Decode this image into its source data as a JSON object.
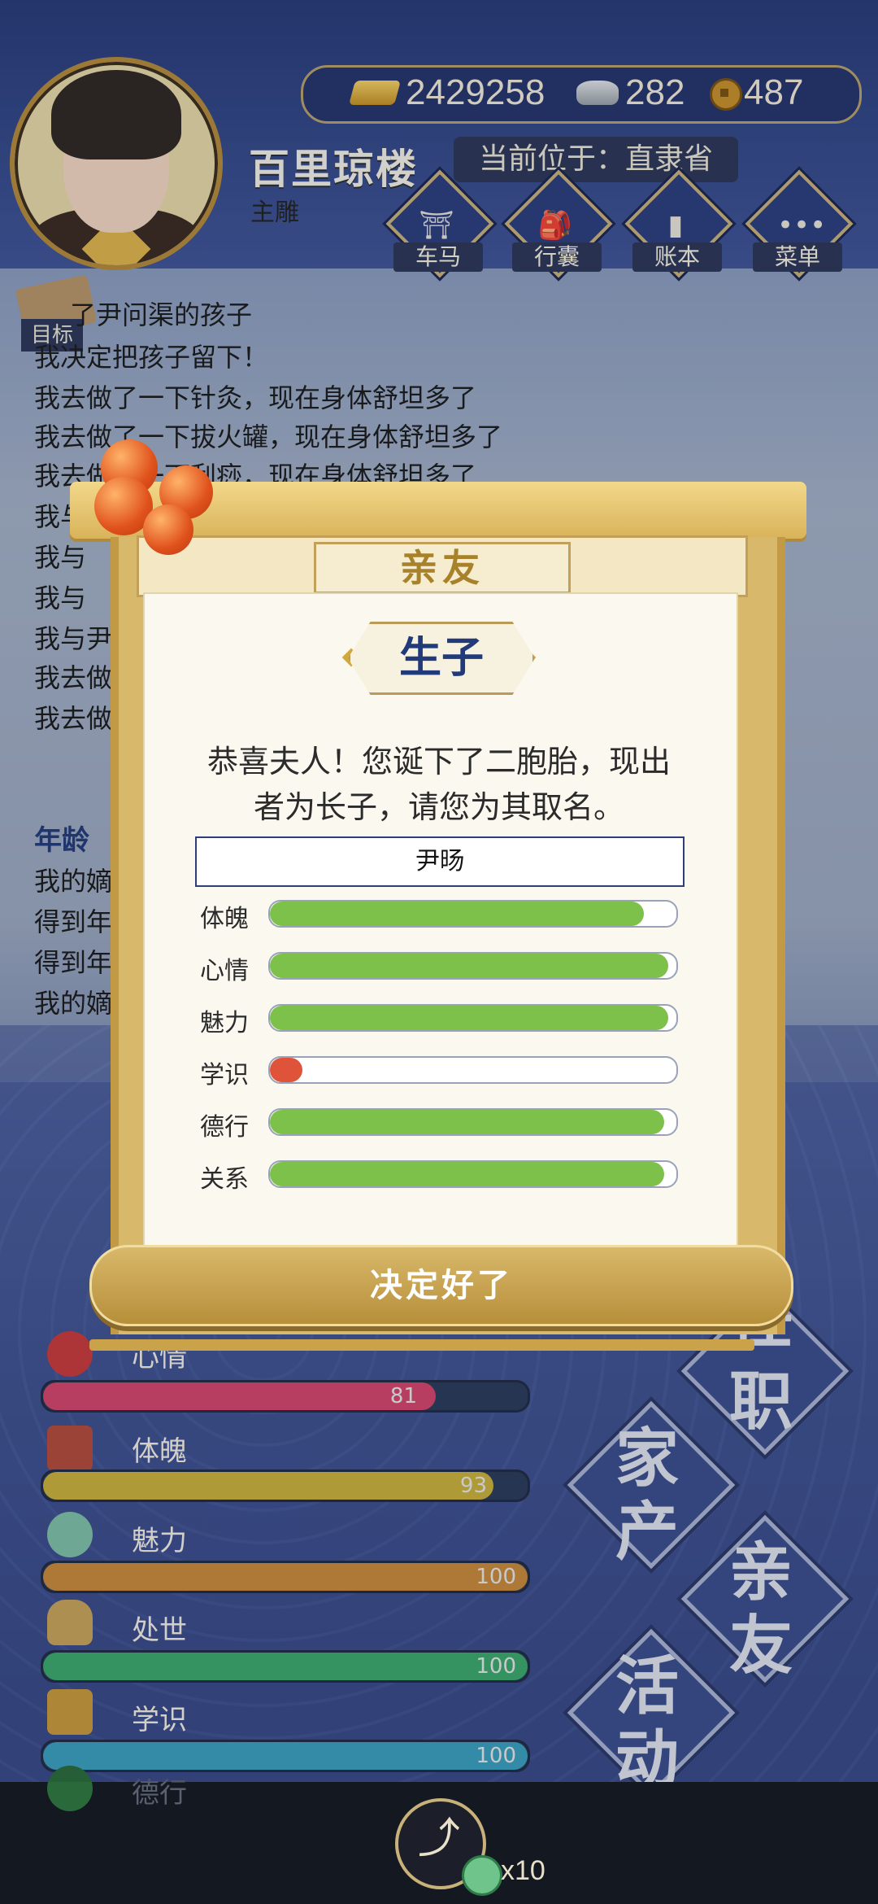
{
  "currency": {
    "gold": "2429258",
    "silver": "282",
    "coins": "487"
  },
  "profile": {
    "name": "百里琼楼",
    "subtitle": "主雕",
    "location": "当前位于：直隶省"
  },
  "nav": [
    {
      "label": "车马",
      "icon": "carriage-icon"
    },
    {
      "label": "行囊",
      "icon": "bag-icon"
    },
    {
      "label": "账本",
      "icon": "ledger-icon"
    },
    {
      "label": "菜单",
      "icon": "menu-icon"
    }
  ],
  "log": {
    "target_label": "目标",
    "lines": [
      "了尹问渠的孩子",
      "我决定把孩子留下！",
      "我去做了一下针灸，现在身体舒坦多了",
      "我去做了一下拔火罐，现在身体舒坦多了",
      "我去做了一下刮痧，现在身体舒坦多了",
      "我与",
      "我与",
      "我与",
      "我与尹",
      "我去做",
      "我去做"
    ],
    "age_label": "年龄",
    "lines2": [
      "我的嫡",
      "得到年",
      "得到年",
      "我的嫡"
    ]
  },
  "stats": [
    {
      "label": "心情",
      "value": 81,
      "display": "81",
      "color": "#d4456b"
    },
    {
      "label": "体魄",
      "value": 93,
      "display": "93",
      "color": "#c9b13a"
    },
    {
      "label": "魅力",
      "value": 100,
      "display": "100",
      "color": "#c98a3a"
    },
    {
      "label": "处世",
      "value": 100,
      "display": "100",
      "color": "#3aa86a"
    },
    {
      "label": "学识",
      "value": 100,
      "display": "100",
      "color": "#3a9fbf"
    },
    {
      "label": "德行",
      "value": null,
      "display": "",
      "color": "#6a2a6a"
    }
  ],
  "tiles": [
    {
      "text1": "任",
      "text2": "职"
    },
    {
      "text1": "家",
      "text2": "产"
    },
    {
      "text1": "亲",
      "text2": "友"
    },
    {
      "text1": "活",
      "text2": "动"
    }
  ],
  "bottom": {
    "count_label": "x10"
  },
  "modal": {
    "title": "亲友",
    "subtitle": "生子",
    "message_line1": "恭喜夫人！您诞下了二胞胎，现出",
    "message_line2": "者为长子，请您为其取名。",
    "name_value": "尹旸",
    "confirm_label": "决定好了",
    "attributes": [
      {
        "label": "体魄",
        "value": 0.92,
        "color": "#7dc04a"
      },
      {
        "label": "心情",
        "value": 0.98,
        "color": "#7dc04a"
      },
      {
        "label": "魅力",
        "value": 0.98,
        "color": "#7dc04a"
      },
      {
        "label": "学识",
        "value": 0.08,
        "color": "#e0533b"
      },
      {
        "label": "德行",
        "value": 0.97,
        "color": "#7dc04a"
      },
      {
        "label": "关系",
        "value": 0.97,
        "color": "#7dc04a"
      }
    ]
  }
}
